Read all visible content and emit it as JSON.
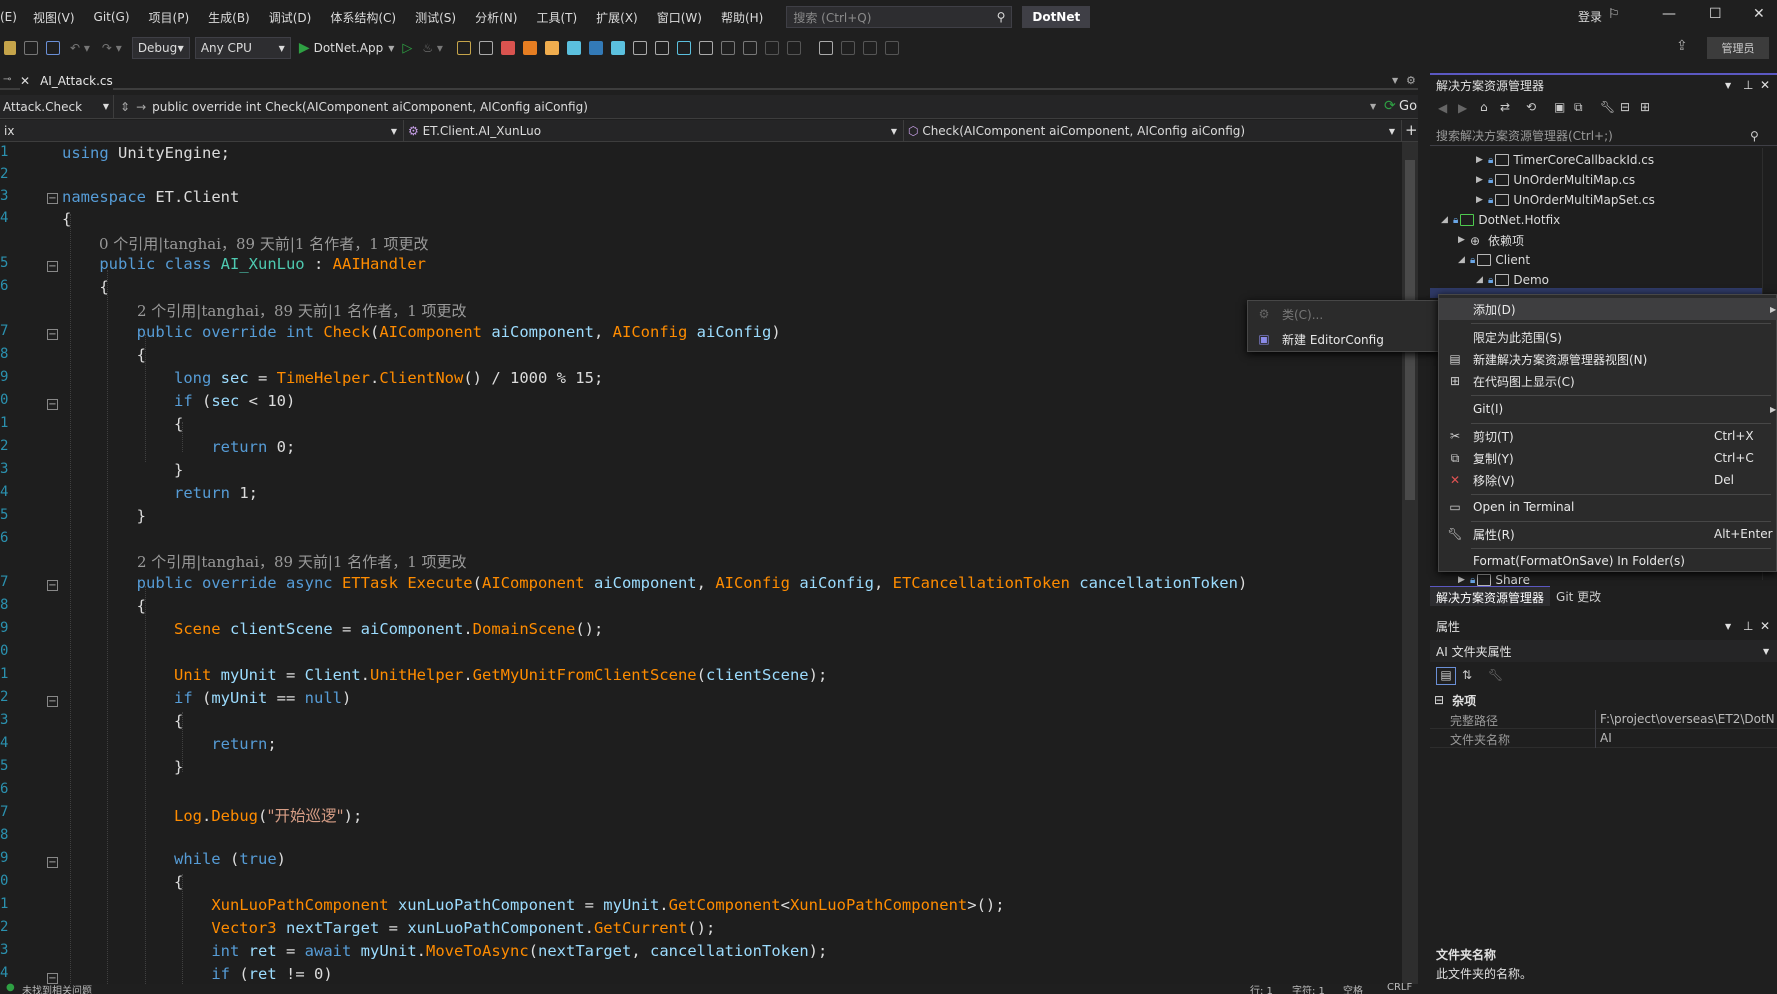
{
  "menubar": {
    "items": [
      "(E)",
      "视图(V)",
      "Git(G)",
      "项目(P)",
      "生成(B)",
      "调试(D)",
      "体系结构(C)",
      "测试(S)",
      "分析(N)",
      "工具(T)",
      "扩展(X)",
      "窗口(W)",
      "帮助(H)"
    ],
    "search_placeholder": "搜索 (Ctrl+Q)",
    "solution_name": "DotNet",
    "login": "登录"
  },
  "toolbar": {
    "config": "Debug",
    "platform": "Any CPU",
    "start_target": "DotNet.App",
    "admin": "管理员"
  },
  "editor": {
    "tab_label": "AI_Attack.cs",
    "nav_scope": "Attack.Check",
    "nav_member_path": "public override int Check(AIComponent aiComponent, AIConfig aiConfig)",
    "go_label": "Go",
    "nav2_project": "ix",
    "nav2_class": "ET.Client.AI_XunLuo",
    "nav2_member": "Check(AIComponent aiComponent, AIConfig aiConfig)",
    "line_numbers": [
      "1",
      "2",
      "3",
      "4",
      "5",
      "6",
      "7",
      "8",
      "9",
      "0",
      "1",
      "2",
      "3",
      "4",
      "5",
      "6",
      "7",
      "8",
      "9",
      "0",
      "1",
      "2",
      "3",
      "4",
      "5",
      "6",
      "7",
      "8",
      "9",
      "0",
      "1",
      "2",
      "3",
      "4",
      "5",
      "6",
      "7",
      "8",
      "9",
      "0",
      "1",
      "2"
    ],
    "lens_1": "0 个引用|tanghai，89 天前|1 名作者，1 项更改",
    "lens_2": "2 个引用|tanghai，89 天前|1 名作者，1 项更改",
    "lens_3": "2 个引用|tanghai，89 天前|1 名作者，1 项更改",
    "log_string": "\"开始巡逻\""
  },
  "solution_explorer": {
    "title": "解决方案资源管理器",
    "search_placeholder": "搜索解决方案资源管理器(Ctrl+;)",
    "tree": [
      {
        "label": "TimerCoreCallbackId.cs"
      },
      {
        "label": "UnOrderMultiMap.cs"
      },
      {
        "label": "UnOrderMultiMapSet.cs"
      },
      {
        "label": "DotNet.Hotfix"
      },
      {
        "label": "依赖项"
      },
      {
        "label": "Client"
      },
      {
        "label": "Demo"
      },
      {
        "label": "Share"
      }
    ],
    "bottom_tabs": [
      "解决方案资源管理器",
      "Git 更改"
    ]
  },
  "context_menu": {
    "items": [
      {
        "label": "添加(D)",
        "shortcut": "",
        "icon": ""
      },
      {
        "label": "限定为此范围(S)",
        "shortcut": "",
        "icon": ""
      },
      {
        "label": "新建解决方案资源管理器视图(N)",
        "shortcut": "",
        "icon": "new-view-icon"
      },
      {
        "label": "在代码图上显示(C)",
        "shortcut": "",
        "icon": "code-map-icon"
      },
      {
        "label": "Git(I)",
        "shortcut": "",
        "icon": ""
      },
      {
        "label": "剪切(T)",
        "shortcut": "Ctrl+X",
        "icon": "scissors-icon"
      },
      {
        "label": "复制(Y)",
        "shortcut": "Ctrl+C",
        "icon": "copy-icon"
      },
      {
        "label": "移除(V)",
        "shortcut": "Del",
        "icon": "remove-icon"
      },
      {
        "label": "Open in Terminal",
        "shortcut": "",
        "icon": "terminal-icon"
      },
      {
        "label": "属性(R)",
        "shortcut": "Alt+Enter",
        "icon": "wrench-icon"
      },
      {
        "label": "Format(FormatOnSave) In Folder(s)",
        "shortcut": "",
        "icon": ""
      }
    ],
    "submenu": [
      {
        "label": "类(C)...",
        "disabled": true
      },
      {
        "label": "新建 EditorConfig",
        "disabled": false
      }
    ]
  },
  "properties": {
    "title": "属性",
    "object": "AI  文件夹属性",
    "category": "杂项",
    "rows": [
      {
        "key": "完整路径",
        "value": "F:\\project\\overseas\\ET2\\DotN"
      },
      {
        "key": "文件夹名称",
        "value": "AI"
      }
    ],
    "desc_title": "文件夹名称",
    "desc_text": "此文件夹的名称。"
  },
  "status": {
    "left": "未找到相关问题",
    "row": "行: 1",
    "col": "字符: 1",
    "spaces": "空格",
    "eol": "CRLF"
  },
  "colors": {
    "keyword": "#569cd6",
    "type": "#ff8c00",
    "selection": "#2f3a67",
    "accent": "#5b58c2"
  }
}
